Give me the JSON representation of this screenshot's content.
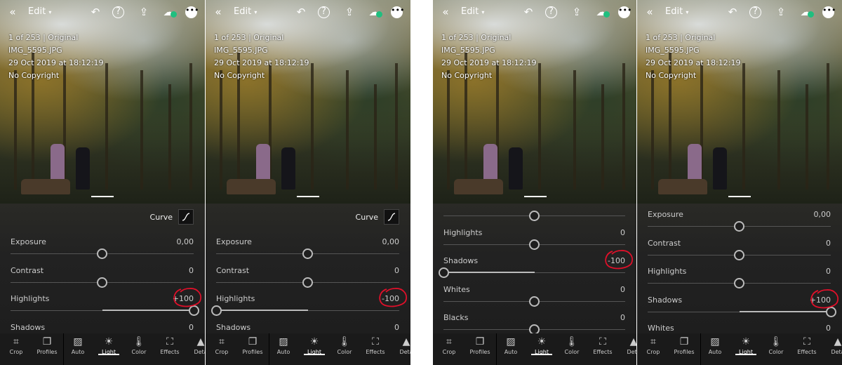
{
  "colors": {
    "annotation": "#e0102a",
    "cloud_status": "#1fbf7f",
    "track_fill": "#bbbbbb"
  },
  "topbar": {
    "title": "Edit",
    "icons": [
      "back-chevron-icon",
      "chevron-down-icon",
      "undo-icon",
      "help-icon",
      "share-icon",
      "cloud-sync-icon",
      "more-icon"
    ]
  },
  "meta": {
    "counter": "1 of 253 | Original",
    "filename": "IMG_5595.JPG",
    "date": "29 Oct 2019 at 18:12:19",
    "copyright": "No Copyright"
  },
  "curve_label": "Curve",
  "toolbar": [
    {
      "label": "Crop",
      "icon": "crop-icon"
    },
    {
      "label": "Profiles",
      "icon": "profiles-icon"
    },
    {
      "label": "Auto",
      "icon": "auto-icon"
    },
    {
      "label": "Light",
      "icon": "light-icon",
      "active": true
    },
    {
      "label": "Color",
      "icon": "color-icon"
    },
    {
      "label": "Effects",
      "icon": "effects-icon"
    },
    {
      "label": "Deta",
      "icon": "detail-icon"
    }
  ],
  "panels": [
    {
      "show_curve": true,
      "sliders": [
        {
          "label": "Exposure",
          "value": "0,00",
          "position": 0
        },
        {
          "label": "Contrast",
          "value": "0",
          "position": 0
        },
        {
          "label": "Highlights",
          "value": "+100",
          "position": 100,
          "annotated": true
        },
        {
          "label": "Shadows",
          "value": "0",
          "position": 0
        }
      ]
    },
    {
      "show_curve": true,
      "sliders": [
        {
          "label": "Exposure",
          "value": "0,00",
          "position": 0
        },
        {
          "label": "Contrast",
          "value": "0",
          "position": 0
        },
        {
          "label": "Highlights",
          "value": "-100",
          "position": -100,
          "annotated": true
        },
        {
          "label": "Shadows",
          "value": "0",
          "position": 0
        }
      ]
    },
    {
      "show_curve": false,
      "sliders": [
        {
          "label": "",
          "value": "",
          "position": 0
        },
        {
          "label": "Highlights",
          "value": "0",
          "position": 0
        },
        {
          "label": "Shadows",
          "value": "-100",
          "position": -100,
          "annotated": true
        },
        {
          "label": "Whites",
          "value": "0",
          "position": 0
        },
        {
          "label": "Blacks",
          "value": "0",
          "position": 0
        }
      ]
    },
    {
      "show_curve": false,
      "sliders": [
        {
          "label": "Exposure",
          "value": "0,00",
          "position": 0
        },
        {
          "label": "Contrast",
          "value": "0",
          "position": 0
        },
        {
          "label": "Highlights",
          "value": "0",
          "position": 0
        },
        {
          "label": "Shadows",
          "value": "+100",
          "position": 100,
          "annotated": true
        },
        {
          "label": "Whites",
          "value": "0",
          "position": 0
        }
      ]
    }
  ]
}
